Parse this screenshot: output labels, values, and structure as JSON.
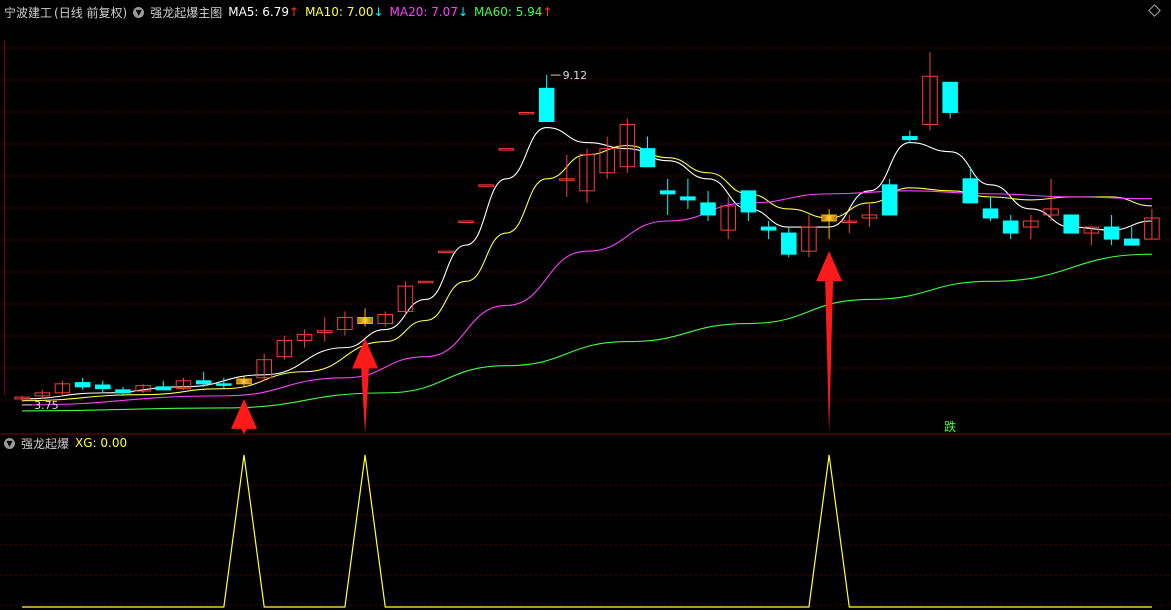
{
  "header": {
    "stock_name": "宁波建工",
    "period": "(日线 前复权)",
    "indicator_name": "强龙起爆主图",
    "ma5": {
      "label": "MA5: 6.79",
      "arrow": "↑",
      "color": "#ffffff"
    },
    "ma10": {
      "label": "MA10: 7.00",
      "arrow": "↓",
      "color": "#ffff4a"
    },
    "ma20": {
      "label": "MA20: 7.07",
      "arrow": "↓",
      "color": "#ff40ff"
    },
    "ma60": {
      "label": "MA60: 5.94",
      "arrow": "↑",
      "color": "#40ff40"
    }
  },
  "sub_header": {
    "indicator_name": "强龙起爆",
    "xg_label": "XG: 0.00"
  },
  "colors": {
    "up": "#ff3c3c",
    "down": "#00ffff",
    "signal": "#ffb400",
    "grid": "#5a0000",
    "separator": "#800000",
    "arrow": "#ff1a1a",
    "xg_line": "#ffff40"
  },
  "chart_data": {
    "type": "candlestick",
    "y_range": [
      3.4,
      10.0
    ],
    "max_label": "9.12",
    "min_label": "3.75",
    "annotation": "跌",
    "candles": [
      [
        3.75,
        3.8,
        3.7,
        3.78
      ],
      [
        3.8,
        3.9,
        3.75,
        3.85
      ],
      [
        3.85,
        4.05,
        3.82,
        4.0
      ],
      [
        4.02,
        4.1,
        3.9,
        3.95
      ],
      [
        3.98,
        4.05,
        3.85,
        3.92
      ],
      [
        3.9,
        3.95,
        3.8,
        3.85
      ],
      [
        3.88,
        4.0,
        3.85,
        3.97
      ],
      [
        3.95,
        4.05,
        3.9,
        3.9
      ],
      [
        3.92,
        4.1,
        3.9,
        4.05
      ],
      [
        4.05,
        4.2,
        3.95,
        4.0
      ],
      [
        4.0,
        4.1,
        3.92,
        3.98
      ],
      [
        4.0,
        4.12,
        3.95,
        4.08
      ],
      [
        4.1,
        4.5,
        4.05,
        4.4
      ],
      [
        4.45,
        4.8,
        4.4,
        4.72
      ],
      [
        4.72,
        4.9,
        4.6,
        4.82
      ],
      [
        4.85,
        5.1,
        4.7,
        4.88
      ],
      [
        4.9,
        5.2,
        4.8,
        5.1
      ],
      [
        5.1,
        5.25,
        4.95,
        5.0
      ],
      [
        5.0,
        5.2,
        4.95,
        5.15
      ],
      [
        5.2,
        5.7,
        5.15,
        5.62
      ],
      [
        5.7,
        5.7,
        5.7,
        5.7
      ],
      [
        6.2,
        6.2,
        6.2,
        6.2
      ],
      [
        6.7,
        6.7,
        6.7,
        6.7
      ],
      [
        7.3,
        7.3,
        7.3,
        7.3
      ],
      [
        7.9,
        7.9,
        7.9,
        7.9
      ],
      [
        8.5,
        8.5,
        8.5,
        8.5
      ],
      [
        8.9,
        9.12,
        8.6,
        8.35
      ],
      [
        7.4,
        7.8,
        7.1,
        7.4
      ],
      [
        7.2,
        7.9,
        7.0,
        7.8
      ],
      [
        7.5,
        8.1,
        7.4,
        7.9
      ],
      [
        7.6,
        8.4,
        7.5,
        8.3
      ],
      [
        7.9,
        8.1,
        7.6,
        7.6
      ],
      [
        7.2,
        7.4,
        6.8,
        7.15
      ],
      [
        7.1,
        7.4,
        6.9,
        7.05
      ],
      [
        7.0,
        7.2,
        6.7,
        6.8
      ],
      [
        6.55,
        7.1,
        6.4,
        6.95
      ],
      [
        7.2,
        7.2,
        6.7,
        6.85
      ],
      [
        6.6,
        6.7,
        6.4,
        6.55
      ],
      [
        6.5,
        6.6,
        6.1,
        6.15
      ],
      [
        6.2,
        6.8,
        6.1,
        6.6
      ],
      [
        6.7,
        6.9,
        6.4,
        6.8
      ],
      [
        6.7,
        6.8,
        6.5,
        6.7
      ],
      [
        6.75,
        7.0,
        6.6,
        6.8
      ],
      [
        7.3,
        7.4,
        6.8,
        6.8
      ],
      [
        8.1,
        8.2,
        8.0,
        8.05
      ],
      [
        8.3,
        9.5,
        8.2,
        9.1
      ],
      [
        9.0,
        9.0,
        8.4,
        8.5
      ],
      [
        7.4,
        7.6,
        7.0,
        7.0
      ],
      [
        6.9,
        7.1,
        6.7,
        6.75
      ],
      [
        6.7,
        6.8,
        6.4,
        6.5
      ],
      [
        6.6,
        6.8,
        6.4,
        6.7
      ],
      [
        6.8,
        7.4,
        6.7,
        6.9
      ],
      [
        6.8,
        6.8,
        6.5,
        6.5
      ],
      [
        6.5,
        6.6,
        6.3,
        6.6
      ],
      [
        6.6,
        6.8,
        6.3,
        6.4
      ],
      [
        6.4,
        6.6,
        6.3,
        6.3
      ],
      [
        6.4,
        6.9,
        6.4,
        6.75
      ]
    ],
    "signal_indices": [
      11,
      17,
      40
    ],
    "ma_lines": [
      {
        "name": "MA5",
        "color": "#ffffff",
        "points": [
          [
            0,
            3.75
          ],
          [
            4,
            3.85
          ],
          [
            8,
            3.95
          ],
          [
            12,
            4.15
          ],
          [
            16,
            4.6
          ],
          [
            18,
            4.9
          ],
          [
            20,
            5.4
          ],
          [
            22,
            6.3
          ],
          [
            24,
            7.4
          ],
          [
            26,
            8.25
          ],
          [
            28,
            8.0
          ],
          [
            30,
            7.9
          ],
          [
            32,
            7.7
          ],
          [
            34,
            7.4
          ],
          [
            36,
            6.9
          ],
          [
            38,
            6.6
          ],
          [
            40,
            6.6
          ],
          [
            42,
            7.2
          ],
          [
            44,
            8.0
          ],
          [
            46,
            7.85
          ],
          [
            48,
            7.3
          ],
          [
            50,
            6.9
          ],
          [
            52,
            6.6
          ],
          [
            54,
            6.55
          ],
          [
            56,
            6.7
          ]
        ]
      },
      {
        "name": "MA10",
        "color": "#ffff4a",
        "points": [
          [
            0,
            3.72
          ],
          [
            6,
            3.82
          ],
          [
            10,
            3.92
          ],
          [
            14,
            4.2
          ],
          [
            18,
            4.7
          ],
          [
            20,
            5.05
          ],
          [
            22,
            5.7
          ],
          [
            24,
            6.5
          ],
          [
            26,
            7.4
          ],
          [
            28,
            7.8
          ],
          [
            30,
            7.95
          ],
          [
            32,
            7.75
          ],
          [
            34,
            7.5
          ],
          [
            36,
            7.15
          ],
          [
            38,
            6.9
          ],
          [
            40,
            6.75
          ],
          [
            42,
            7.0
          ],
          [
            44,
            7.25
          ],
          [
            46,
            7.2
          ],
          [
            48,
            7.1
          ],
          [
            50,
            7.05
          ],
          [
            52,
            7.1
          ],
          [
            54,
            7.1
          ],
          [
            56,
            6.95
          ]
        ]
      },
      {
        "name": "MA20",
        "color": "#ff40ff",
        "points": [
          [
            0,
            3.65
          ],
          [
            10,
            3.8
          ],
          [
            16,
            4.1
          ],
          [
            20,
            4.45
          ],
          [
            24,
            5.3
          ],
          [
            28,
            6.2
          ],
          [
            32,
            6.7
          ],
          [
            36,
            7.0
          ],
          [
            40,
            7.15
          ],
          [
            44,
            7.2
          ],
          [
            48,
            7.15
          ],
          [
            52,
            7.1
          ],
          [
            56,
            7.07
          ]
        ]
      },
      {
        "name": "MA60",
        "color": "#40ff40",
        "points": [
          [
            0,
            3.55
          ],
          [
            10,
            3.6
          ],
          [
            18,
            3.85
          ],
          [
            24,
            4.3
          ],
          [
            30,
            4.7
          ],
          [
            36,
            5.0
          ],
          [
            42,
            5.4
          ],
          [
            48,
            5.7
          ],
          [
            56,
            6.15
          ]
        ]
      }
    ],
    "xg_values": [
      0,
      0,
      0,
      0,
      0,
      0,
      0,
      0,
      0,
      0,
      0,
      1,
      0,
      0,
      0,
      0,
      0,
      1,
      0,
      0,
      0,
      0,
      0,
      0,
      0,
      0,
      0,
      0,
      0,
      0,
      0,
      0,
      0,
      0,
      0,
      0,
      0,
      0,
      0,
      0,
      1,
      0,
      0,
      0,
      0,
      0,
      0,
      0,
      0,
      0,
      0,
      0,
      0,
      0,
      0,
      0,
      0
    ]
  }
}
